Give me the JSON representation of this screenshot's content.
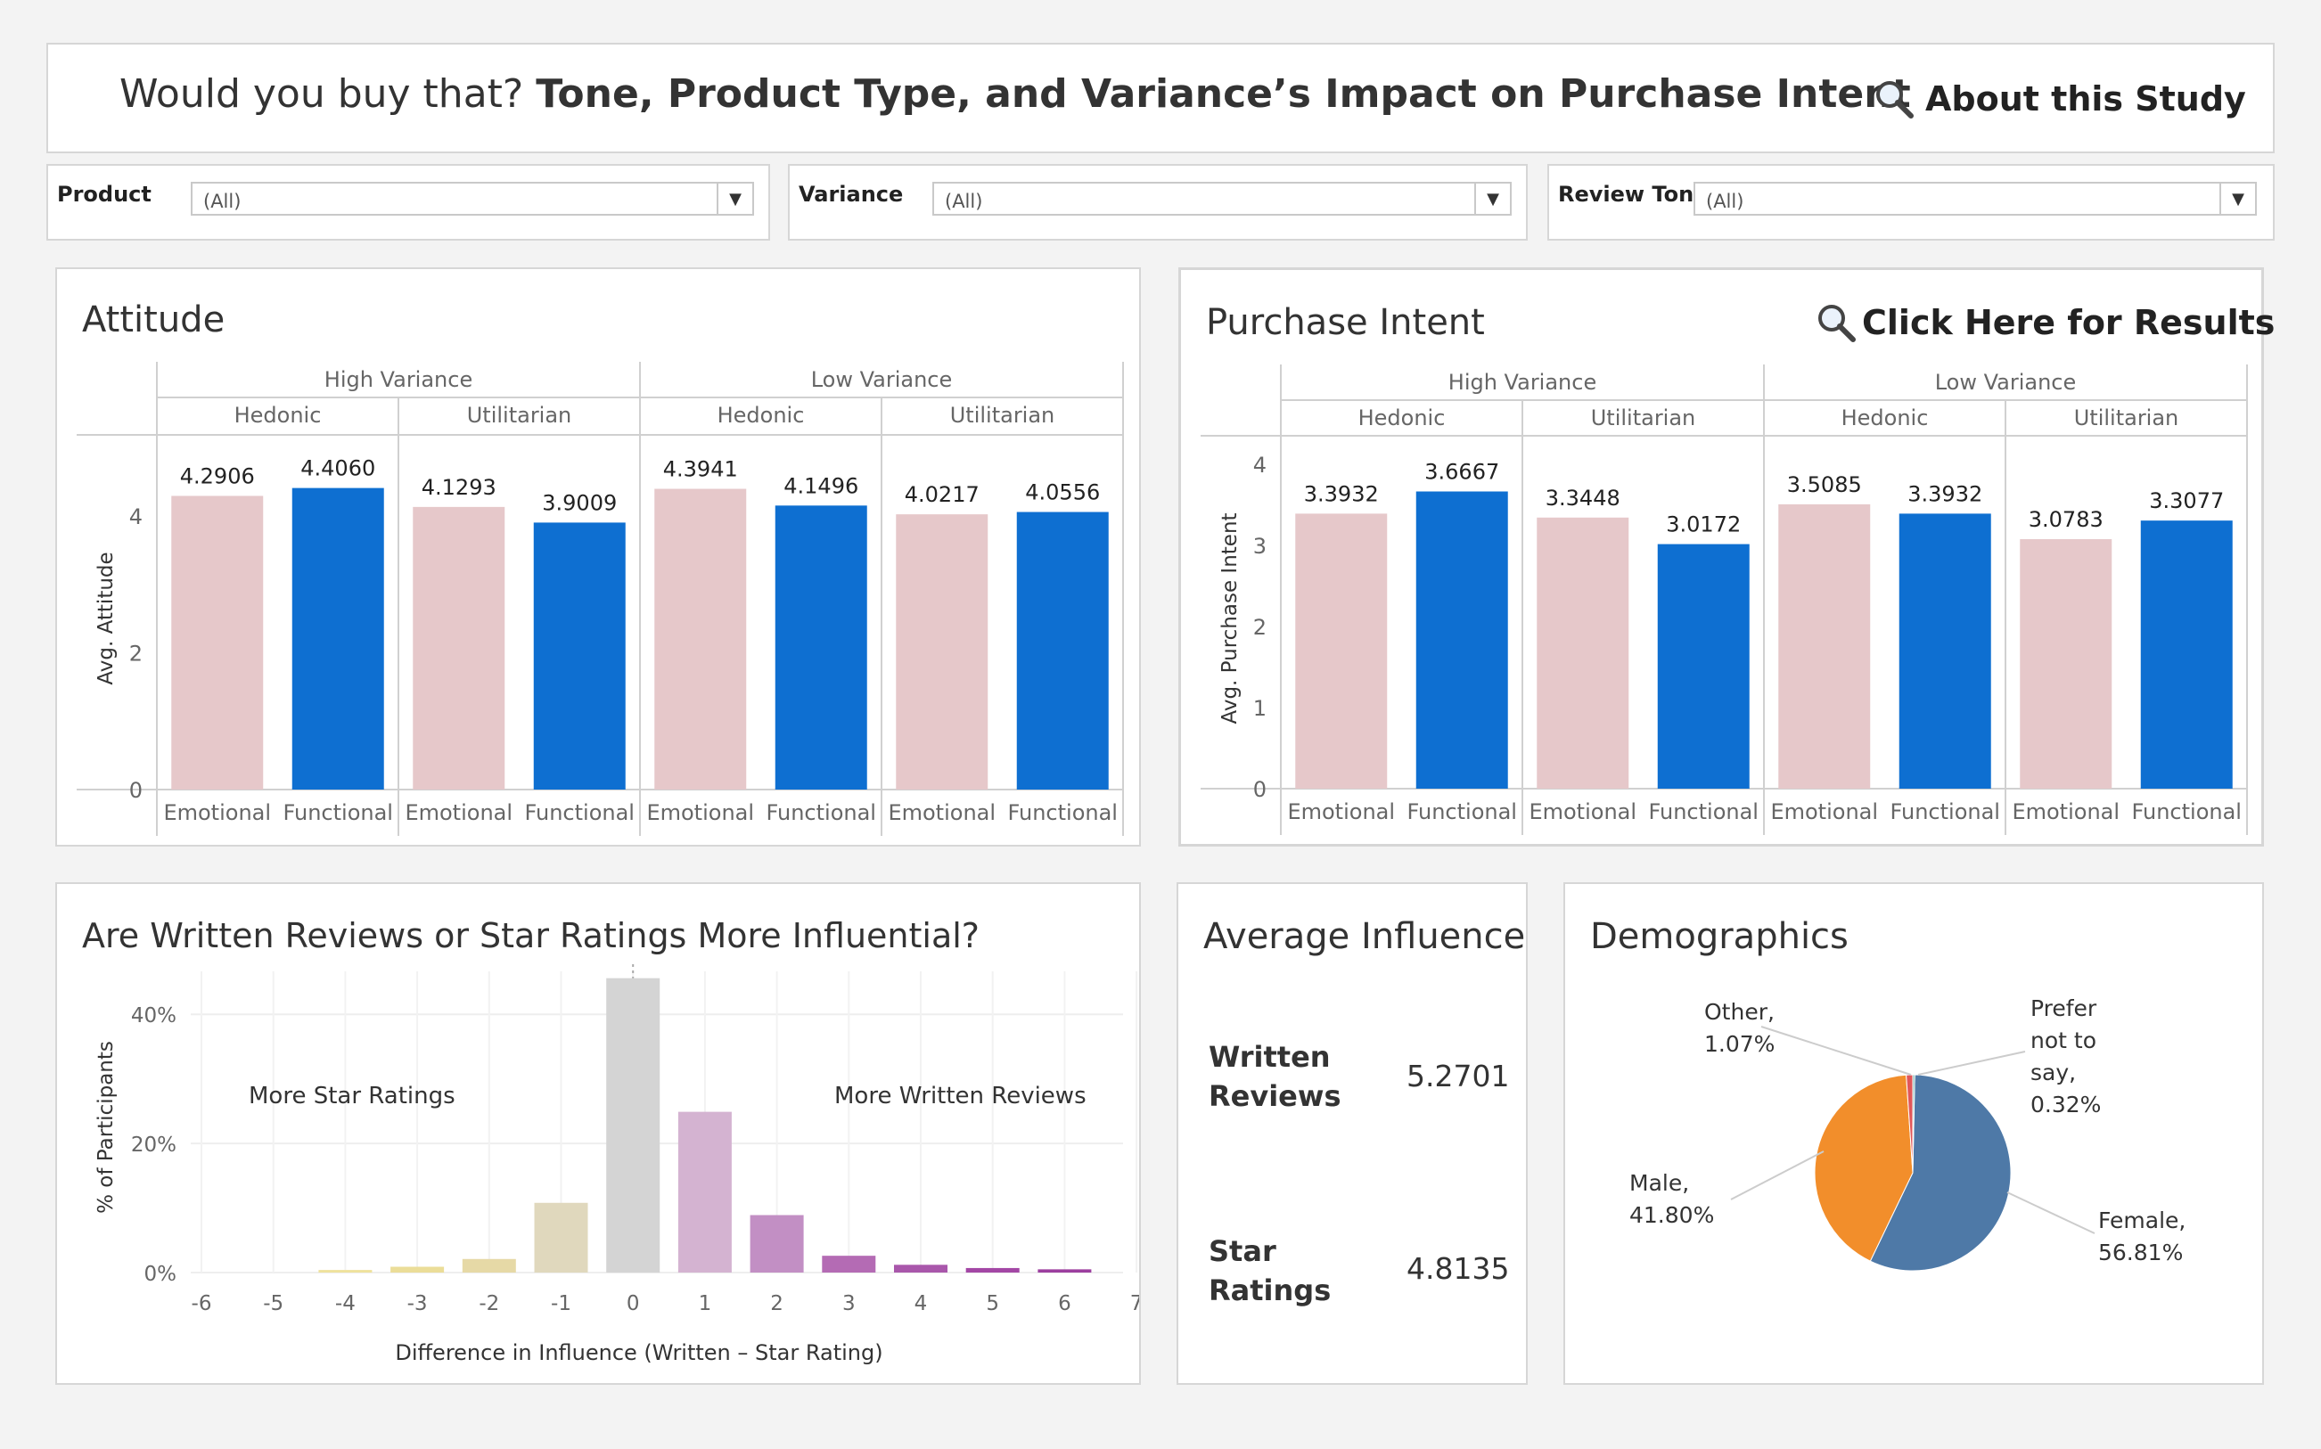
{
  "header": {
    "title_part1": "Would you buy that?",
    "title_part2": "Tone, Product Type, and Variance’s Impact on Purchase Intent",
    "about_label": "About this Study"
  },
  "filters": [
    {
      "label": "Product",
      "value": "(All)"
    },
    {
      "label": "Variance",
      "value": "(All)"
    },
    {
      "label": "Review Tone",
      "value": "(All)"
    }
  ],
  "colors": {
    "emotional": "#e6c8ca",
    "functional": "#0e6fd1",
    "grid": "#ececec",
    "axis": "#d0d0d0"
  },
  "attitude": {
    "title": "Attitude",
    "ylabel": "Avg. Attitude",
    "groups": [
      "High Variance",
      "Low Variance"
    ],
    "subgroups": [
      "Hedonic",
      "Utilitarian",
      "Hedonic",
      "Utilitarian"
    ],
    "categories": [
      "Emotional",
      "Functional",
      "Emotional",
      "Functional",
      "Emotional",
      "Functional",
      "Emotional",
      "Functional"
    ],
    "labels": [
      "4.2906",
      "4.4060",
      "4.1293",
      "3.9009",
      "4.3941",
      "4.1496",
      "4.0217",
      "4.0556"
    ],
    "ticks": [
      "0",
      "2",
      "4"
    ]
  },
  "purchase": {
    "title": "Purchase Intent",
    "results_label": "Click Here for Results",
    "ylabel": "Avg. Purchase Intent",
    "groups": [
      "High Variance",
      "Low Variance"
    ],
    "subgroups": [
      "Hedonic",
      "Utilitarian",
      "Hedonic",
      "Utilitarian"
    ],
    "categories": [
      "Emotional",
      "Functional",
      "Emotional",
      "Functional",
      "Emotional",
      "Functional",
      "Emotional",
      "Functional"
    ],
    "labels": [
      "3.3932",
      "3.6667",
      "3.3448",
      "3.0172",
      "3.5085",
      "3.3932",
      "3.0783",
      "3.3077"
    ],
    "ticks": [
      "0",
      "1",
      "2",
      "3",
      "4"
    ]
  },
  "influence": {
    "title": "Are Written Reviews or Star Ratings More Influential?",
    "ylabel": "% of Participants",
    "xlabel": "Difference in Influence (Written – Star Rating)",
    "left_annotation": "More Star Ratings",
    "right_annotation": "More Written Reviews",
    "ticks_y": [
      "0%",
      "20%",
      "40%"
    ],
    "ticks_x": [
      "-6",
      "-5",
      "-4",
      "-3",
      "-2",
      "-1",
      "0",
      "1",
      "2",
      "3",
      "4",
      "5",
      "6",
      "7"
    ]
  },
  "average_influence": {
    "title": "Average Influence",
    "items": [
      {
        "label_line1": "Written",
        "label_line2": "Reviews",
        "value": "5.2701"
      },
      {
        "label_line1": "Star",
        "label_line2": "Ratings",
        "value": "4.8135"
      }
    ]
  },
  "demographics": {
    "title": "Demographics",
    "slices": [
      {
        "name": "Female",
        "value": 56.81,
        "label_line1": "Female,",
        "label_line2": "56.81%",
        "color": "#4e79a7"
      },
      {
        "name": "Male",
        "value": 41.8,
        "label_line1": "Male,",
        "label_line2": "41.80%",
        "color": "#f28e2b"
      },
      {
        "name": "Other",
        "value": 1.07,
        "label_line1": "Other,",
        "label_line2": "1.07%",
        "color": "#e15759"
      },
      {
        "name": "Prefer not to say",
        "value": 0.32,
        "label_line1": "Prefer",
        "label_line2": "not to",
        "label_line3": "say,",
        "label_line4": "0.32%",
        "color": "#76b7b2"
      }
    ]
  },
  "chart_data": [
    {
      "type": "bar",
      "title": "Attitude",
      "ylabel": "Avg. Attitude",
      "ylim": [
        0,
        5
      ],
      "categories": [
        "High Variance / Hedonic",
        "High Variance / Utilitarian",
        "Low Variance / Hedonic",
        "Low Variance / Utilitarian"
      ],
      "series": [
        {
          "name": "Emotional",
          "values": [
            4.2906,
            4.1293,
            4.3941,
            4.0217
          ]
        },
        {
          "name": "Functional",
          "values": [
            4.406,
            3.9009,
            4.1496,
            4.0556
          ]
        }
      ]
    },
    {
      "type": "bar",
      "title": "Purchase Intent",
      "ylabel": "Avg. Purchase Intent",
      "ylim": [
        0,
        4.2
      ],
      "categories": [
        "High Variance / Hedonic",
        "High Variance / Utilitarian",
        "Low Variance / Hedonic",
        "Low Variance / Utilitarian"
      ],
      "series": [
        {
          "name": "Emotional",
          "values": [
            3.3932,
            3.3448,
            3.5085,
            3.0783
          ]
        },
        {
          "name": "Functional",
          "values": [
            3.6667,
            3.0172,
            3.3932,
            3.3077
          ]
        }
      ]
    },
    {
      "type": "bar",
      "title": "Are Written Reviews or Star Ratings More Influential?",
      "xlabel": "Difference in Influence (Written – Star Rating)",
      "ylabel": "% of Participants",
      "ylim": [
        0,
        45
      ],
      "x": [
        -6,
        -5,
        -4,
        -3,
        -2,
        -1,
        0,
        1,
        2,
        3,
        4,
        5,
        6,
        7
      ],
      "values": [
        0,
        0,
        0.4,
        0.9,
        2.1,
        10.8,
        45.6,
        24.9,
        8.9,
        2.6,
        1.2,
        0.7,
        0.5,
        0
      ],
      "colors": [
        "#f0e6a8",
        "#f0e6a8",
        "#efe29c",
        "#ebdd98",
        "#e6d9a6",
        "#e0d8bd",
        "#d4d4d4",
        "#d4b3d1",
        "#c28fc4",
        "#b46bb4",
        "#a957ab",
        "#a347a5",
        "#9c3f9f",
        "#9c3f9f"
      ]
    },
    {
      "type": "pie",
      "title": "Demographics",
      "categories": [
        "Female",
        "Male",
        "Other",
        "Prefer not to say"
      ],
      "values": [
        56.81,
        41.8,
        1.07,
        0.32
      ]
    }
  ]
}
